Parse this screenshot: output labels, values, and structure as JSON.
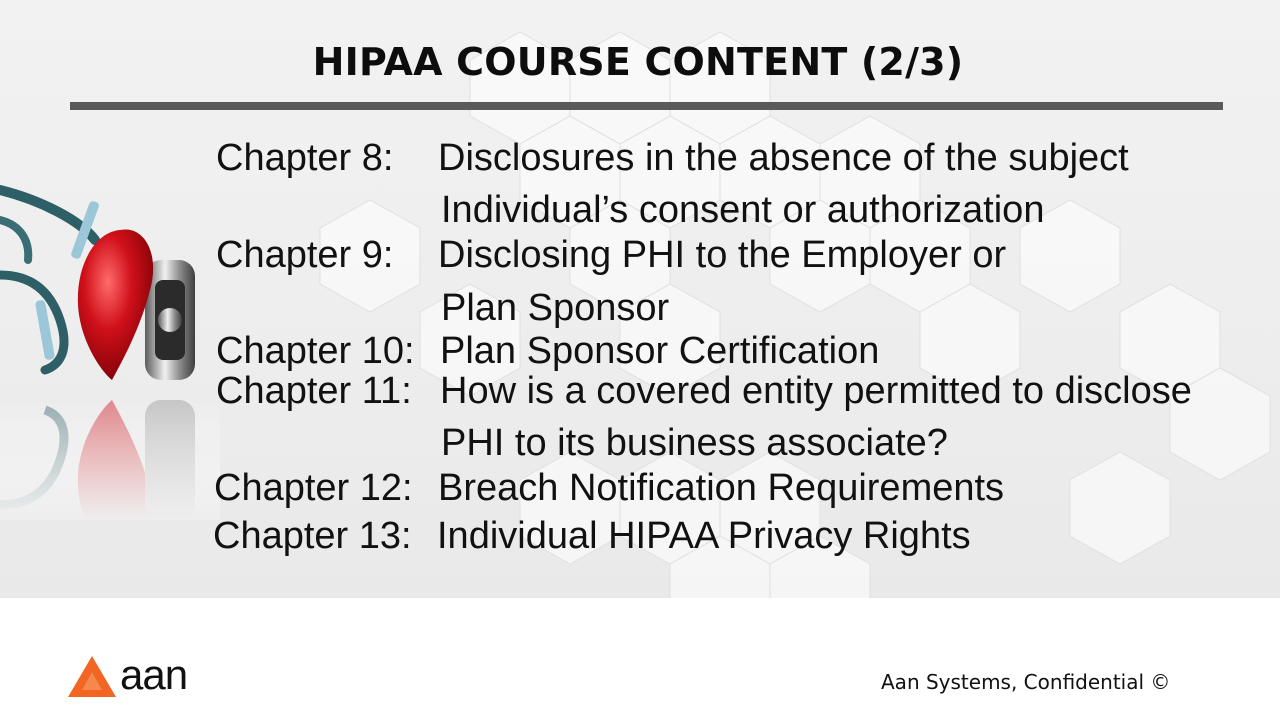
{
  "slide": {
    "title": "HIPAA COURSE CONTENT (2/3)",
    "chapters": [
      {
        "label": "Chapter 8:",
        "text": "Disclosures in the absence of the subject",
        "continuation": "Individual’s consent or authorization"
      },
      {
        "label": "Chapter 9:",
        "text": "Disclosing PHI to the Employer or",
        "continuation": "Plan Sponsor"
      },
      {
        "label": "Chapter 10:",
        "text": "Plan Sponsor Certification"
      },
      {
        "label": "Chapter 11:",
        "text": "How is a covered entity permitted to disclose",
        "continuation": "PHI to its business associate?"
      },
      {
        "label": "Chapter 12:",
        "text": "Breach Notification Requirements"
      },
      {
        "label": "Chapter 13:",
        "text": "Individual HIPAA Privacy Rights"
      }
    ]
  },
  "footer": {
    "logo_text": "aan",
    "confidential": "Aan Systems, Confidential ©"
  },
  "colors": {
    "title_rule": "#5a5a5a",
    "logo_accent": "#f26522",
    "heart_red": "#d0101a"
  },
  "images": {
    "decoration": "stethoscope-heart-image"
  }
}
